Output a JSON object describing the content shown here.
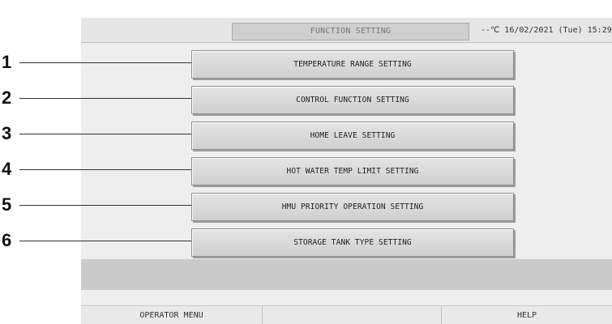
{
  "header": {
    "title": "FUNCTION SETTING",
    "status": "--℃  16/02/2021 (Tue) 15:29"
  },
  "function_buttons": [
    {
      "label": "TEMPERATURE RANGE SETTING"
    },
    {
      "label": "CONTROL FUNCTION SETTING"
    },
    {
      "label": "HOME LEAVE SETTING"
    },
    {
      "label": "HOT WATER TEMP LIMIT SETTING"
    },
    {
      "label": "HMU PRIORITY OPERATION SETTING"
    },
    {
      "label": "STORAGE TANK TYPE SETTING"
    }
  ],
  "callouts": [
    "1",
    "2",
    "3",
    "4",
    "5",
    "6"
  ],
  "footer": {
    "operator_menu": "OPERATOR MENU",
    "middle": "",
    "help": "HELP"
  }
}
